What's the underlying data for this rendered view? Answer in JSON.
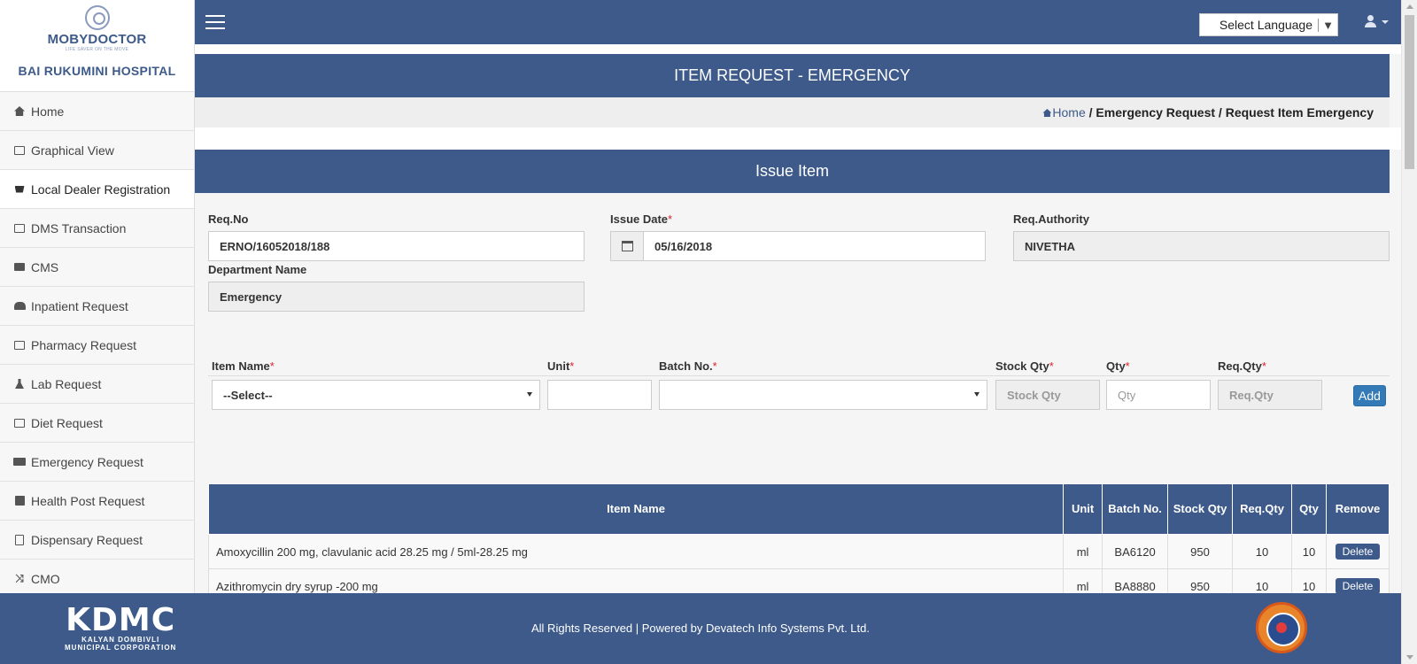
{
  "brand": {
    "logo_title": "MOBYDOCTOR",
    "logo_tagline": "LIFE SAVER ON THE MOVE",
    "hospital": "BAI RUKUMINI HOSPITAL"
  },
  "sidebar": {
    "items": [
      {
        "label": "Home",
        "icon": "home-icon"
      },
      {
        "label": "Graphical View",
        "icon": "picture-icon"
      },
      {
        "label": "Local Dealer Registration",
        "icon": "cart-icon"
      },
      {
        "label": "DMS Transaction",
        "icon": "share-icon"
      },
      {
        "label": "CMS",
        "icon": "list-icon"
      },
      {
        "label": "Inpatient Request",
        "icon": "users-icon"
      },
      {
        "label": "Pharmacy Request",
        "icon": "camera-icon"
      },
      {
        "label": "Lab Request",
        "icon": "flask-icon"
      },
      {
        "label": "Diet Request",
        "icon": "chart-icon"
      },
      {
        "label": "Emergency Request",
        "icon": "ambulance-icon"
      },
      {
        "label": "Health Post Request",
        "icon": "hospital-icon"
      },
      {
        "label": "Dispensary Request",
        "icon": "clipboard-icon"
      },
      {
        "label": "CMO",
        "icon": "shuffle-icon"
      }
    ]
  },
  "header": {
    "language_label": "Select Language",
    "language_arrow": "▼"
  },
  "page": {
    "title": "ITEM REQUEST - EMERGENCY"
  },
  "breadcrumb": {
    "home": "Home",
    "rest": " / Emergency Request / Request Item Emergency"
  },
  "panel": {
    "title": "Issue Item"
  },
  "form": {
    "req_no_label": "Req.No",
    "req_no_value": "ERNO/16052018/188",
    "issue_date_label": "Issue Date",
    "issue_date_value": "05/16/2018",
    "req_authority_label": "Req.Authority",
    "req_authority_value": "NIVETHA",
    "department_label": "Department Name",
    "department_value": "Emergency",
    "required_mark": "*"
  },
  "item_entry": {
    "item_name_label": "Item Name",
    "item_name_value": "--Select--",
    "unit_label": "Unit",
    "batch_label": "Batch No.",
    "stock_qty_label": "Stock Qty",
    "stock_qty_placeholder": "Stock Qty",
    "qty_label": "Qty",
    "qty_placeholder": "Qty",
    "req_qty_label": "Req.Qty",
    "req_qty_placeholder": "Req.Qty",
    "add_label": "Add"
  },
  "table": {
    "headers": {
      "item_name": "Item Name",
      "unit": "Unit",
      "batch": "Batch No.",
      "stock_qty": "Stock Qty",
      "req_qty": "Req.Qty",
      "qty": "Qty",
      "remove": "Remove"
    },
    "rows": [
      {
        "item_name": "Amoxycillin 200 mg, clavulanic acid 28.25 mg / 5ml-28.25 mg",
        "unit": "ml",
        "batch": "BA6120",
        "stock_qty": "950",
        "req_qty": "10",
        "qty": "10",
        "remove": "Delete"
      },
      {
        "item_name": "Azithromycin dry syrup -200 mg",
        "unit": "ml",
        "batch": "BA8880",
        "stock_qty": "950",
        "req_qty": "10",
        "qty": "10",
        "remove": "Delete"
      }
    ]
  },
  "footer": {
    "kdmc_big": "KDMC",
    "kdmc_line1": "KALYAN DOMBIVLI",
    "kdmc_line2": "MUNICIPAL CORPORATION",
    "text": "All Rights Reserved | Powered by Devatech Info Systems Pvt. Ltd."
  },
  "colors": {
    "primary": "#3d5a8a",
    "add_button": "#337ab7",
    "required": "#d9232d"
  }
}
